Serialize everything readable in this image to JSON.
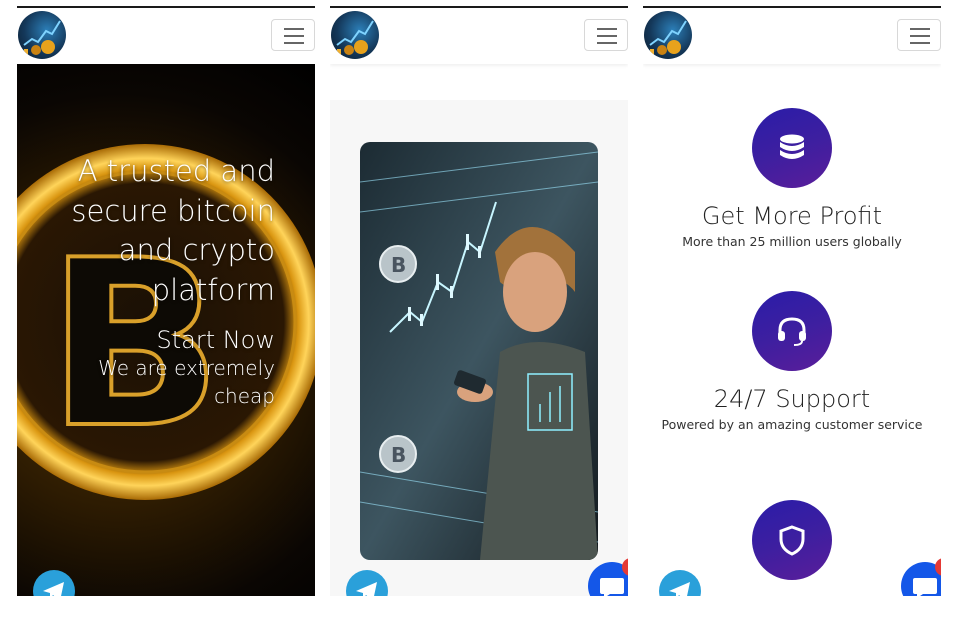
{
  "hero": {
    "title": "A trusted and secure bitcoin and crypto platform",
    "cta": "Start Now",
    "subtitle": "We are extremely cheap"
  },
  "features": [
    {
      "icon": "database-icon",
      "title": "Get More Profit",
      "desc": "More than 25 million users globally"
    },
    {
      "icon": "headset-icon",
      "title": "24/7 Support",
      "desc": "Powered by an amazing customer service"
    },
    {
      "icon": "shield-icon",
      "title": "",
      "desc": ""
    }
  ],
  "chat": {
    "badge": "1"
  },
  "colors": {
    "accent": "#3a1fa3",
    "telegram": "#2aa0da",
    "chat": "#1457e8",
    "gold": "#e0a020"
  }
}
